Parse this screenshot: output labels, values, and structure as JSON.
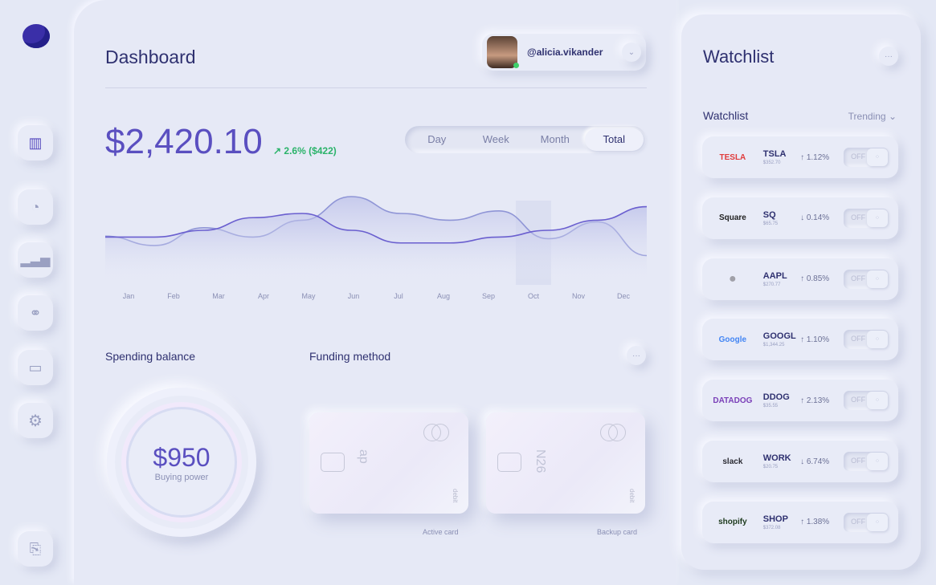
{
  "header": {
    "title": "Dashboard",
    "username": "@alicia.vikander"
  },
  "balance": {
    "amount": "$2,420.10",
    "change": "2.6% ($422)",
    "change_color": "#2bb36a"
  },
  "range_tabs": [
    {
      "label": "Day"
    },
    {
      "label": "Week"
    },
    {
      "label": "Month"
    },
    {
      "label": "Total",
      "active": true
    }
  ],
  "chart_data": {
    "type": "area",
    "categories": [
      "Jan",
      "Feb",
      "Mar",
      "Apr",
      "May",
      "Jun",
      "Jul",
      "Aug",
      "Sep",
      "Oct",
      "Nov",
      "Dec"
    ],
    "series": [
      {
        "values": [
          53,
          42,
          63,
          52,
          72,
          100,
          80,
          72,
          83,
          50,
          70,
          30
        ],
        "color": "#8f95d6"
      },
      {
        "values": [
          52,
          52,
          60,
          75,
          80,
          60,
          45,
          45,
          52,
          60,
          72,
          88
        ],
        "color": "#6a5fcf"
      }
    ],
    "highlight": "Oct",
    "grid": false
  },
  "spending": {
    "title": "Spending balance",
    "amount": "$950",
    "label": "Buying power"
  },
  "funding": {
    "title": "Funding method",
    "cards": [
      {
        "label": "Active card",
        "type": "debit",
        "mark": "ap"
      },
      {
        "label": "Backup card",
        "type": "debit",
        "mark": "N26"
      }
    ]
  },
  "watchlist": {
    "title": "Watchlist",
    "subtitle": "Watchlist",
    "filter": "Trending",
    "toggle_label": "OFF",
    "items": [
      {
        "brand": "TESLA",
        "brand_color": "#e03b3b",
        "symbol": "TSLA",
        "price": "$352.70",
        "dir": "up",
        "change": "1.12%"
      },
      {
        "brand": "Square",
        "brand_color": "#222222",
        "symbol": "SQ",
        "price": "$65.75",
        "dir": "down",
        "change": "0.14%"
      },
      {
        "brand": "",
        "brand_color": "#a0a0a8",
        "symbol": "AAPL",
        "price": "$270.77",
        "dir": "up",
        "change": "0.85%"
      },
      {
        "brand": "Google",
        "brand_color": "#4285f4",
        "symbol": "GOOGL",
        "price": "$1,344.25",
        "dir": "up",
        "change": "1.10%"
      },
      {
        "brand": "DATADOG",
        "brand_color": "#7a3fb8",
        "symbol": "DDOG",
        "price": "$35.55",
        "dir": "up",
        "change": "2.13%"
      },
      {
        "brand": "slack",
        "brand_color": "#2b2b33",
        "symbol": "WORK",
        "price": "$20.75",
        "dir": "down",
        "change": "6.74%"
      },
      {
        "brand": "shopify",
        "brand_color": "#1d3a1d",
        "symbol": "SHOP",
        "price": "$372.08",
        "dir": "up",
        "change": "1.38%"
      }
    ]
  }
}
